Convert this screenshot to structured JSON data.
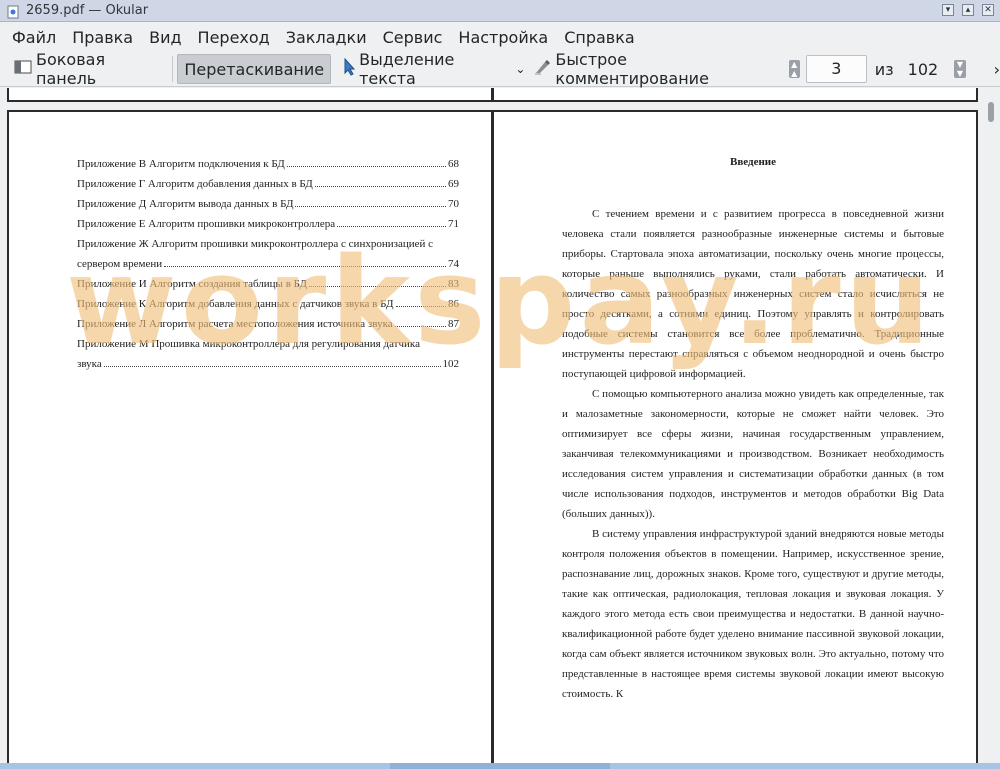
{
  "window": {
    "title": "2659.pdf — Okular",
    "controls": [
      "minimize-icon",
      "maximize-icon",
      "close-icon"
    ]
  },
  "menu": {
    "items": [
      "Файл",
      "Правка",
      "Вид",
      "Переход",
      "Закладки",
      "Сервис",
      "Настройка",
      "Справка"
    ]
  },
  "toolbar": {
    "sidebar_label": "Боковая панель",
    "browse_label": "Перетаскивание",
    "text_select_label": "Выделение текста",
    "quick_annot_label": "Быстрое комментирование",
    "page_current": "3",
    "page_of_label": "из",
    "page_total": "102"
  },
  "page_left": {
    "toc": [
      {
        "text": "Приложение В Алгоритм подключения к БД",
        "page": "68"
      },
      {
        "text": "Приложение Г Алгоритм добавления данных в БД",
        "page": "69"
      },
      {
        "text": "Приложение Д Алгоритм вывода данных в БД",
        "page": "70"
      },
      {
        "text": "Приложение Е Алгоритм прошивки микроконтроллера",
        "page": "71"
      },
      {
        "text_line1": "Приложение Ж Алгоритм прошивки микроконтроллера с синхронизацией с",
        "text": "сервером времени",
        "page": "74"
      },
      {
        "text": "Приложение И Алгоритм создания таблицы в БД",
        "page": "83"
      },
      {
        "text": "Приложение К Алгоритм добавления данных с датчиков звука в БД",
        "page": "86"
      },
      {
        "text": "Приложение Л Алгоритм расчета местоположения источника звука",
        "page": "87"
      },
      {
        "text_line1": "Приложение М Прошивка микроконтроллера для регулирования датчика",
        "text": "звука",
        "page": "102"
      }
    ]
  },
  "page_right": {
    "heading": "Введение",
    "paragraphs": [
      "С течением времени и с развитием прогресса в повседневной жизни человека стали появляется разнообразные инженерные системы и бытовые приборы. Стартовала эпоха автоматизации, поскольку очень многие процессы, которые раньше выполнялись руками, стали работать автоматически. И количество самых разнообразных инженерных систем стало исчисляться не просто десятками, а сотнями единиц. Поэтому управлять и контролировать подобные системы становится все более проблематично. Традиционные инструменты перестают справляться с объемом неоднородной и очень быстро поступающей цифровой информацией.",
      "С помощью компьютерного анализа можно увидеть как определенные, так и малозаметные закономерности, которые не сможет найти человек. Это оптимизирует все сферы жизни, начиная государственным управлением, заканчивая телекоммуникациями и производством. Возникает необходимость исследования систем управления и систематизации обработки данных (в том числе использования подходов, инструментов и методов обработки Big Data (больших данных)).",
      "В систему управления инфраструктурой зданий внедряются новые методы контроля положения объектов в помещении. Например, искусственное зрение, распознавание лиц, дорожных знаков. Кроме того, существуют и другие методы, такие как оптическая, радиолокация, тепловая локация и звуковая локация. У каждого этого метода есть свои преимущества и недостатки. В данной научно-квалификационной работе будет уделено внимание пассивной звуковой локации, когда сам объект является источником звуковых волн. Это актуально, потому что представленные в настоящее время системы звуковой локации имеют высокую стоимость. К"
    ]
  },
  "watermark": "workspay.ru"
}
